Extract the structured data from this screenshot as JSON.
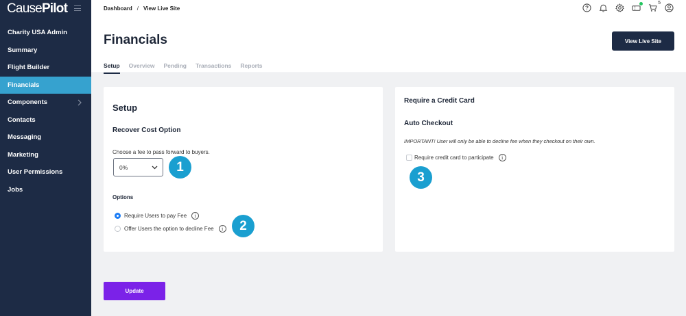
{
  "app": {
    "logo_part1": "Cause",
    "logo_part2": "Pilot"
  },
  "sidebar": {
    "items": [
      {
        "label": "Charity USA Admin",
        "active": false
      },
      {
        "label": "Summary",
        "active": false
      },
      {
        "label": "Flight Builder",
        "active": false
      },
      {
        "label": "Financials",
        "active": true
      },
      {
        "label": "Components",
        "active": false,
        "has_chevron": true
      },
      {
        "label": "Contacts",
        "active": false
      },
      {
        "label": "Messaging",
        "active": false
      },
      {
        "label": "Marketing",
        "active": false
      },
      {
        "label": "User Permissions",
        "active": false
      },
      {
        "label": "Jobs",
        "active": false
      }
    ]
  },
  "breadcrumb": {
    "items": [
      "Dashboard",
      "View Live Site"
    ],
    "separator": "/"
  },
  "topbar": {
    "icons": [
      "help-icon",
      "bell-icon",
      "gear-icon",
      "ticket-icon",
      "cart-icon",
      "user-icon"
    ],
    "cart_count": "5"
  },
  "header": {
    "title": "Financials",
    "view_live_site": "View Live Site",
    "tabs": [
      "Setup",
      "Overview",
      "Pending",
      "Transactions",
      "Reports"
    ]
  },
  "setup_card": {
    "title": "Setup",
    "recover_heading": "Recover Cost Option",
    "fee_label": "Choose a fee to pass forward to buyers.",
    "fee_value": "0%",
    "options_heading": "Options",
    "option_require": "Require Users to pay Fee",
    "option_decline": "Offer Users the option to decline Fee",
    "selected_option": "option_require"
  },
  "cc_card": {
    "title": "Require a Credit Card",
    "auto_heading": "Auto Checkout",
    "important": "IMPORTANT! User will only be able to decline fee when they checkout on their own.",
    "checkbox_label": "Require credit card to participate",
    "checkbox_checked": false
  },
  "markers": [
    "1",
    "2",
    "3"
  ],
  "info_glyph": "i",
  "update_label": "Update",
  "colors": {
    "sidebar_bg": "#1d2b45",
    "active_nav": "#36a2cf",
    "marker": "#1a9fd0",
    "update_button": "#7b22e8",
    "radio_checked": "#1b7cf5"
  }
}
